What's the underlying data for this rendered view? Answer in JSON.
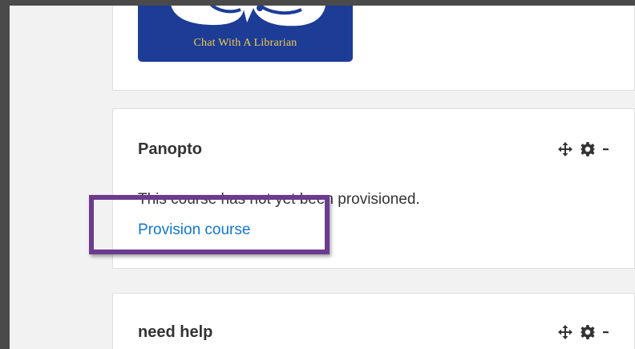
{
  "chat_block": {
    "logo_text": "Chat With A Librarian"
  },
  "panopto_block": {
    "title": "Panopto",
    "message": "This course has not yet been provisioned.",
    "link_label": "Provision course"
  },
  "help_block": {
    "title": "need help"
  },
  "controls": {
    "icons": [
      "move-icon",
      "gear-icon",
      "caret-down-icon"
    ]
  },
  "colors": {
    "background": "#4a4a4a",
    "page": "#f2f2f2",
    "logo_bg": "#1d3c96",
    "logo_text": "#f2c94c",
    "link": "#1177d1",
    "highlight": "#6c3a8f"
  }
}
